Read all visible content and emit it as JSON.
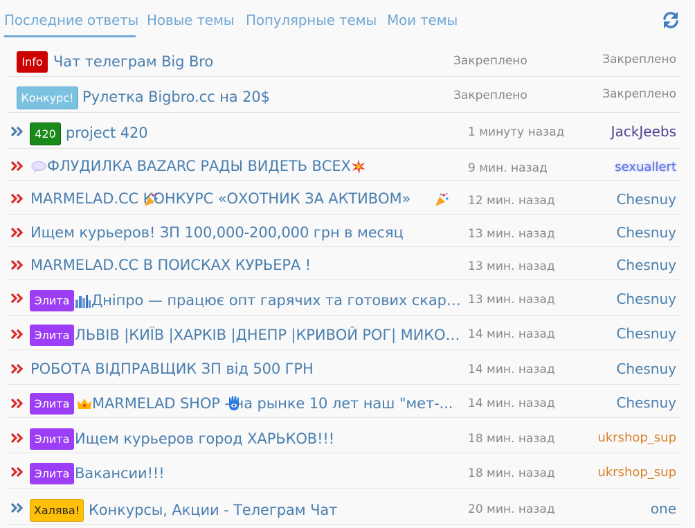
{
  "tabs": [
    {
      "label": "Последние ответы",
      "active": true
    },
    {
      "label": "Новые темы",
      "active": false
    },
    {
      "label": "Популярные темы",
      "active": false
    },
    {
      "label": "Мои темы",
      "active": false
    }
  ],
  "colors": {
    "accent": "#72a8d4",
    "link": "#4a7fae",
    "muted": "#888888",
    "prefix_info": "#cc0000",
    "prefix_konkurs": "#7bc1e0",
    "prefix_420": "#1a8a1a",
    "prefix_elite": "#9b3ef5",
    "prefix_halyava": "#ffc107",
    "chevron_hot": "#d92b2b",
    "chevron_normal": "#4a7fae"
  },
  "threads": [
    {
      "prefix": "Info",
      "title": "Чат телеграм Big Bro",
      "time": "Закреплено",
      "author": "Закреплено",
      "chevron": "none"
    },
    {
      "prefix": "Конкурс!",
      "title": "Рулетка Bigbro.cc на 20$",
      "time": "Закреплено",
      "author": "Закреплено",
      "chevron": "none"
    },
    {
      "prefix": "420",
      "title": "project 420",
      "time": "1 минуту назад",
      "author": "JackJeebs",
      "chevron": "normal"
    },
    {
      "prefix": "",
      "title": "ФЛУДИЛКА  BAZARC  РАДЫ ВИДЕТЬ ВСЕХ",
      "time": "9 мин. назад",
      "author": "sexuallert",
      "chevron": "hot"
    },
    {
      "prefix": "",
      "title": "MARMELAD.CC  КОНКУРС «ОХОТНИК ЗА АКТИВОМ»",
      "time": "12 мин. назад",
      "author": "Chesnuy",
      "chevron": "hot"
    },
    {
      "prefix": "",
      "title": "Ищем курьеров! ЗП 100,000-200,000 грн в месяц",
      "time": "13 мин. назад",
      "author": "Chesnuy",
      "chevron": "hot"
    },
    {
      "prefix": "",
      "title": "MARMELAD.CC В ПОИСКАХ КУРЬЕРА !",
      "time": "13 мин. назад",
      "author": "Chesnuy",
      "chevron": "hot"
    },
    {
      "prefix": "Элита",
      "title": "Дніпро — працює опт гарячих та готових скарбів ...",
      "time": "13 мин. назад",
      "author": "Chesnuy",
      "chevron": "hot"
    },
    {
      "prefix": "Элита",
      "title": "ЛЬВІВ |КИЇВ |ХАРКІВ |ДНЕПР |КРИВОЙ РОГ| МИКОЛА...",
      "time": "14 мин. назад",
      "author": "Chesnuy",
      "chevron": "hot"
    },
    {
      "prefix": "",
      "title": "РОБОТА ВІДПРАВЩИК ЗП від 500 ГРН",
      "time": "14 мин. назад",
      "author": "Chesnuy",
      "chevron": "hot"
    },
    {
      "prefix": "Элита",
      "title": "MARMELAD SHOP   - на рынке 10 лет наш \"мет-...",
      "time": "14 мин. назад",
      "author": "Chesnuy",
      "chevron": "hot"
    },
    {
      "prefix": "Элита",
      "title": "Ищем курьеров город ХАРЬКОВ!!!",
      "time": "18 мин. назад",
      "author": "ukrshop_sup",
      "chevron": "hot"
    },
    {
      "prefix": "Элита",
      "title": "Вакансии!!!",
      "time": "18 мин. назад",
      "author": "ukrshop_sup",
      "chevron": "hot"
    },
    {
      "prefix": "Халява!",
      "title": "Конкурсы, Акции - Телеграм Чат",
      "time": "20 мин. назад",
      "author": "one",
      "chevron": "normal"
    }
  ]
}
